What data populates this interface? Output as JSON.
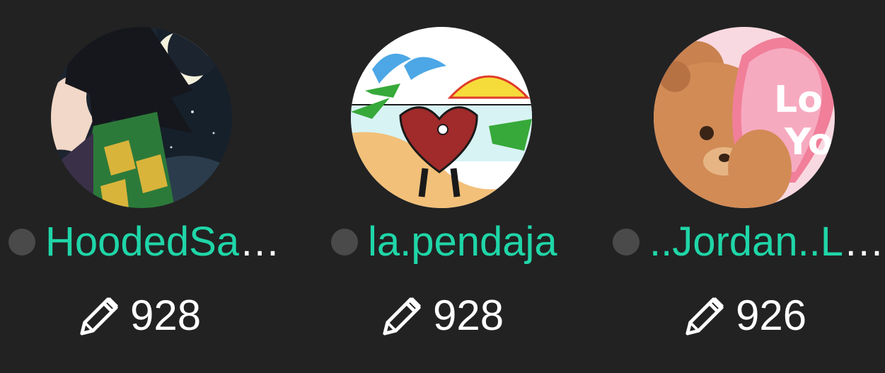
{
  "users": [
    {
      "name_visible": "HoodedSa",
      "truncation": "…",
      "status": "offline",
      "score": "928",
      "avatar_icon": "anime-character-moon-avatar"
    },
    {
      "name_visible": "la.pendaja",
      "truncation": "",
      "status": "offline",
      "score": "928",
      "avatar_icon": "heart-beach-drawing-avatar"
    },
    {
      "name_visible": "..Jordan..L",
      "truncation": "…",
      "status": "offline",
      "score": "926",
      "avatar_icon": "teddy-bear-love-heart-avatar"
    }
  ],
  "colors": {
    "background": "#222222",
    "username": "#1fd6a8",
    "status_offline": "#4a4a4a",
    "text": "#ffffff"
  },
  "icons": {
    "score_icon": "pencil-icon"
  }
}
